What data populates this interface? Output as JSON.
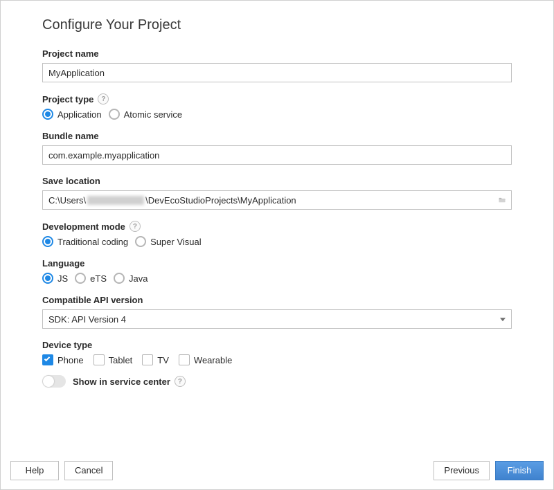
{
  "title": "Configure Your Project",
  "project_name": {
    "label": "Project name",
    "value": "MyApplication"
  },
  "project_type": {
    "label": "Project type",
    "options": [
      "Application",
      "Atomic service"
    ],
    "selected": 0
  },
  "bundle_name": {
    "label": "Bundle name",
    "value": "com.example.myapplication"
  },
  "save_location": {
    "label": "Save location",
    "prefix": "C:\\Users\\",
    "suffix": "\\DevEcoStudioProjects\\MyApplication"
  },
  "dev_mode": {
    "label": "Development mode",
    "options": [
      "Traditional coding",
      "Super Visual"
    ],
    "selected": 0
  },
  "language": {
    "label": "Language",
    "options": [
      "JS",
      "eTS",
      "Java"
    ],
    "selected": 0
  },
  "api_version": {
    "label": "Compatible API version",
    "value": "SDK: API Version 4"
  },
  "device_type": {
    "label": "Device type",
    "options": [
      {
        "label": "Phone",
        "checked": true
      },
      {
        "label": "Tablet",
        "checked": false
      },
      {
        "label": "TV",
        "checked": false
      },
      {
        "label": "Wearable",
        "checked": false
      }
    ]
  },
  "service_center": {
    "label": "Show in service center",
    "on": false
  },
  "footer": {
    "help": "Help",
    "cancel": "Cancel",
    "previous": "Previous",
    "finish": "Finish"
  }
}
